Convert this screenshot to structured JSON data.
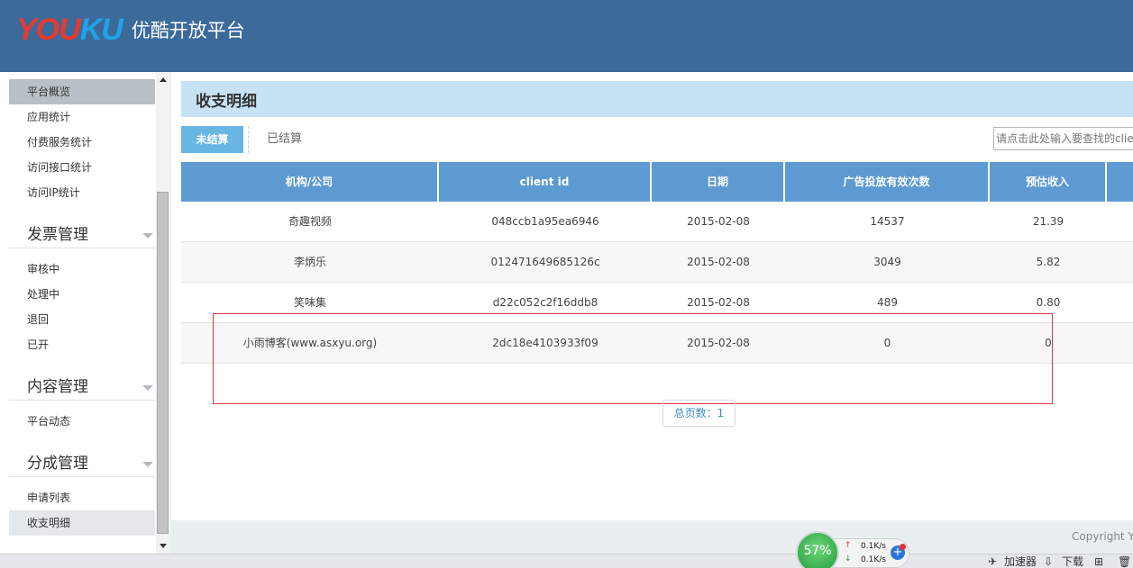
{
  "header": {
    "logo_you": "YOU",
    "logo_ku": "KU",
    "title": "优酷开放平台"
  },
  "sidebar": {
    "top_items": [
      {
        "label": "平台概览"
      },
      {
        "label": "应用统计"
      },
      {
        "label": "付费服务统计"
      },
      {
        "label": "访问接口统计"
      },
      {
        "label": "访问IP统计"
      }
    ],
    "groups": [
      {
        "title": "发票管理",
        "items": [
          {
            "label": "审核中"
          },
          {
            "label": "处理中"
          },
          {
            "label": "退回"
          },
          {
            "label": "已开"
          }
        ]
      },
      {
        "title": "内容管理",
        "items": [
          {
            "label": "平台动态"
          }
        ]
      },
      {
        "title": "分成管理",
        "items": [
          {
            "label": "申请列表"
          },
          {
            "label": "收支明细"
          }
        ]
      }
    ]
  },
  "main": {
    "page_title": "收支明细",
    "tabs": [
      {
        "label": "未结算"
      },
      {
        "label": "已结算"
      }
    ],
    "search_placeholder": "请点击此处输入要查找的clie",
    "columns": [
      "机构/公司",
      "client id",
      "日期",
      "广告投放有效次数",
      "预估收入"
    ],
    "rows": [
      {
        "company": "奇趣视频",
        "client_id": "048ccb1a95ea6946",
        "date": "2015-02-08",
        "count": "14537",
        "income": "21.39"
      },
      {
        "company": "李炳乐",
        "client_id": "012471649685126c",
        "date": "2015-02-08",
        "count": "3049",
        "income": "5.82"
      },
      {
        "company": "笑味集",
        "client_id": "d22c052c2f16ddb8",
        "date": "2015-02-08",
        "count": "489",
        "income": "0.80"
      },
      {
        "company": "小雨博客(www.asxyu.org)",
        "client_id": "2dc18e4103933f09",
        "date": "2015-02-08",
        "count": "0",
        "income": "0"
      }
    ],
    "pager": "总页数：1"
  },
  "footer": {
    "copyright": "Copyright Yo"
  },
  "speed_widget": {
    "percent": "57%",
    "up": "0.1K/s",
    "down": "0.1K/s"
  },
  "statusbar": {
    "accelerator": "加速器",
    "download": "下载"
  },
  "colors": {
    "header_bg": "#3b6a9b",
    "table_header_bg": "#5d9ad1",
    "tab_active_bg": "#69b6e3",
    "title_bar_bg": "#c8e2f5",
    "highlight_border": "#e0373a"
  }
}
